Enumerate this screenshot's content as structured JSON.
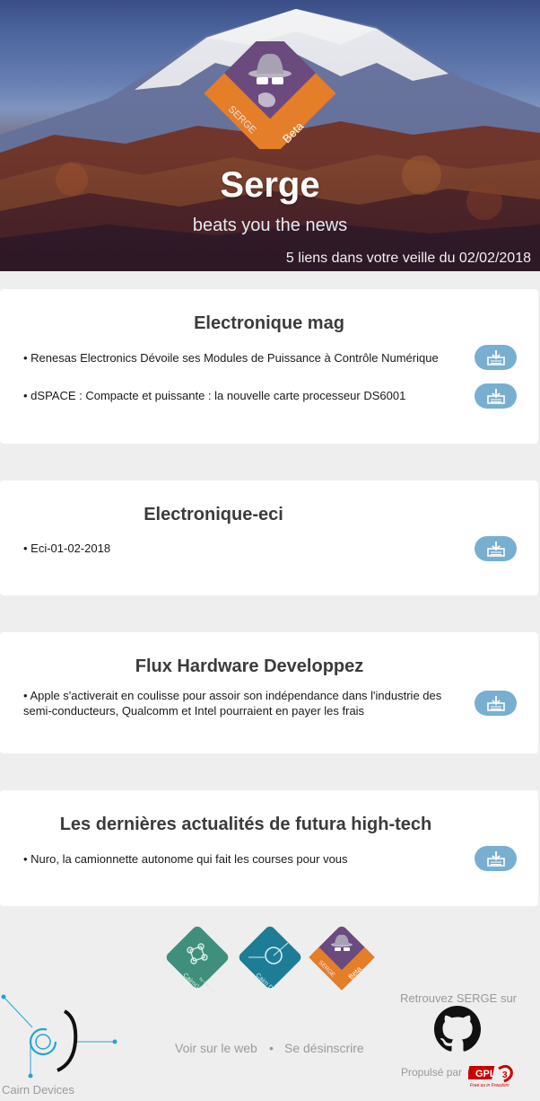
{
  "header": {
    "title": "Serge",
    "subtitle": "beats you the news",
    "summary": "5 liens dans votre veille du 02/02/2018",
    "logo": {
      "name": "SERGE",
      "badge": "Beta"
    }
  },
  "sections": [
    {
      "title": "Electronique mag",
      "items": [
        "• Renesas Electronics Dévoile ses Modules de Puissance à Contrôle Numérique",
        "• dSPACE : Compacte et puissante : la nouvelle carte processeur DS6001"
      ]
    },
    {
      "title": "Electronique-eci",
      "items": [
        "• Eci-01-02-2018"
      ]
    },
    {
      "title": "Flux Hardware Developpez",
      "items": [
        "• Apple s'activerait en coulisse pour assoir son indépendance dans l'industrie des semi-conducteurs, Qualcomm et Intel pourraient en payer les frais"
      ]
    },
    {
      "title": "Les dernières actualités de futura high-tech",
      "items": [
        "• Nuro, la camionnette autonome qui fait les courses pour vous"
      ]
    }
  ],
  "footer": {
    "logos": [
      {
        "name": "CairnGit",
        "sub": "by Cairn Devices"
      },
      {
        "name": "Cairn Devices"
      },
      {
        "name": "SERGE",
        "badge": "Beta"
      }
    ],
    "links": {
      "web": "Voir sur le web",
      "separator": "•",
      "unsubscribe": "Se désinscrire"
    },
    "retrouvez": "Retrouvez SERGE sur",
    "propulse": "Propulsé par",
    "gpl": {
      "name": "GPL",
      "version": "3",
      "tagline": "Free as in Freedom"
    },
    "company": "Cairn Devices"
  },
  "colors": {
    "accent": "#78afd0",
    "serge_purple": "#6b4a7e",
    "beta_orange": "#e57e29",
    "git_green": "#3f8f7c",
    "cairn_teal": "#1d7d96"
  },
  "icons": {
    "download": "download-icon",
    "github": "github-icon"
  }
}
